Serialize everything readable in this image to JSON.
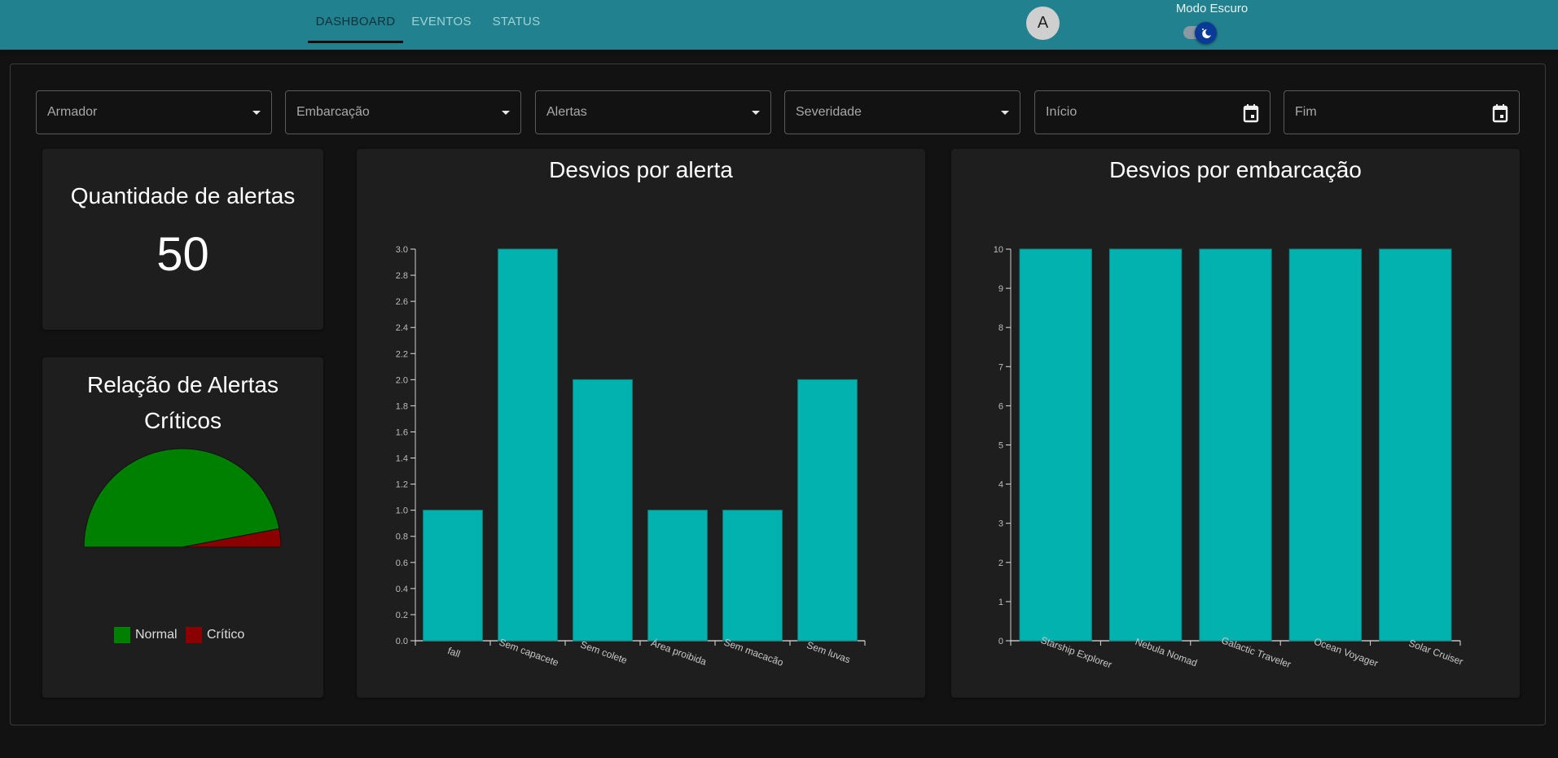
{
  "nav": {
    "tabs": [
      {
        "label": "DASHBOARD",
        "active": true
      },
      {
        "label": "EVENTOS",
        "active": false
      },
      {
        "label": "STATUS",
        "active": false
      }
    ],
    "avatar_initial": "A",
    "dark_mode_label": "Modo Escuro",
    "dark_mode_on": true
  },
  "filters": [
    {
      "label": "Armador",
      "type": "select",
      "icon": "caret-down-icon"
    },
    {
      "label": "Embarcação",
      "type": "select",
      "icon": "caret-down-icon"
    },
    {
      "label": "Alertas",
      "type": "select",
      "icon": "caret-down-icon"
    },
    {
      "label": "Severidade",
      "type": "select",
      "icon": "caret-down-icon"
    },
    {
      "label": "Início",
      "type": "date",
      "icon": "calendar-icon"
    },
    {
      "label": "Fim",
      "type": "date",
      "icon": "calendar-icon"
    }
  ],
  "kpi": {
    "title": "Quantidade de alertas",
    "value": "50"
  },
  "colors": {
    "header": "#22818e",
    "bar": "#02b2af",
    "normal": "#008000",
    "critical": "#8b0000"
  },
  "chart_data": [
    {
      "type": "pie",
      "title_line1": "Relação de Alertas",
      "title_line2": "Críticos",
      "variant": "half-donut (semicircle)",
      "slices": [
        {
          "name": "Normal",
          "value": 47,
          "color": "#008000"
        },
        {
          "name": "Crítico",
          "value": 3,
          "color": "#8b0000"
        }
      ],
      "legend": [
        "Normal",
        "Crítico"
      ],
      "legend_position": "bottom"
    },
    {
      "type": "bar",
      "title": "Desvios por alerta",
      "categories": [
        "fall",
        "Sem capacete",
        "Sem colete",
        "Área proibida",
        "Sem macacão",
        "Sem luvas"
      ],
      "values": [
        1,
        3,
        2,
        1,
        1,
        2
      ],
      "ylim": [
        0,
        3.0
      ],
      "yticks": [
        "0.0",
        "0.2",
        "0.4",
        "0.6",
        "0.8",
        "1.0",
        "1.2",
        "1.4",
        "1.6",
        "1.8",
        "2.0",
        "2.2",
        "2.4",
        "2.6",
        "2.8",
        "3.0"
      ],
      "xlabel": "",
      "ylabel": "",
      "grid": false
    },
    {
      "type": "bar",
      "title": "Desvios por embarcação",
      "categories": [
        "Starship Explorer",
        "Nebula Nomad",
        "Galactic Traveler",
        "Ocean Voyager",
        "Solar Cruiser"
      ],
      "values": [
        10,
        10,
        10,
        10,
        10
      ],
      "ylim": [
        0,
        10
      ],
      "yticks": [
        "0",
        "1",
        "2",
        "3",
        "4",
        "5",
        "6",
        "7",
        "8",
        "9",
        "10"
      ],
      "xlabel": "",
      "ylabel": "",
      "grid": false
    }
  ]
}
